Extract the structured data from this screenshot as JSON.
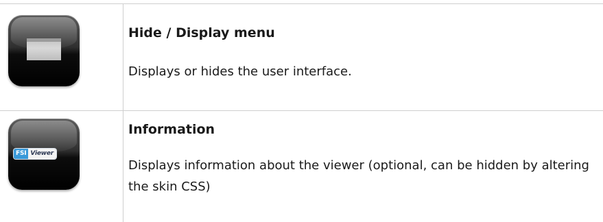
{
  "rows": [
    {
      "icon": "hide-display-menu-icon",
      "title": "Hide / Display menu",
      "description": "Displays or hides the user interface."
    },
    {
      "icon": "information-icon",
      "icon_badge": {
        "left": "FSI",
        "right": "Viewer"
      },
      "title": "Information",
      "description": "Displays information about the viewer (optional, can be hidden by altering the skin CSS)"
    }
  ]
}
